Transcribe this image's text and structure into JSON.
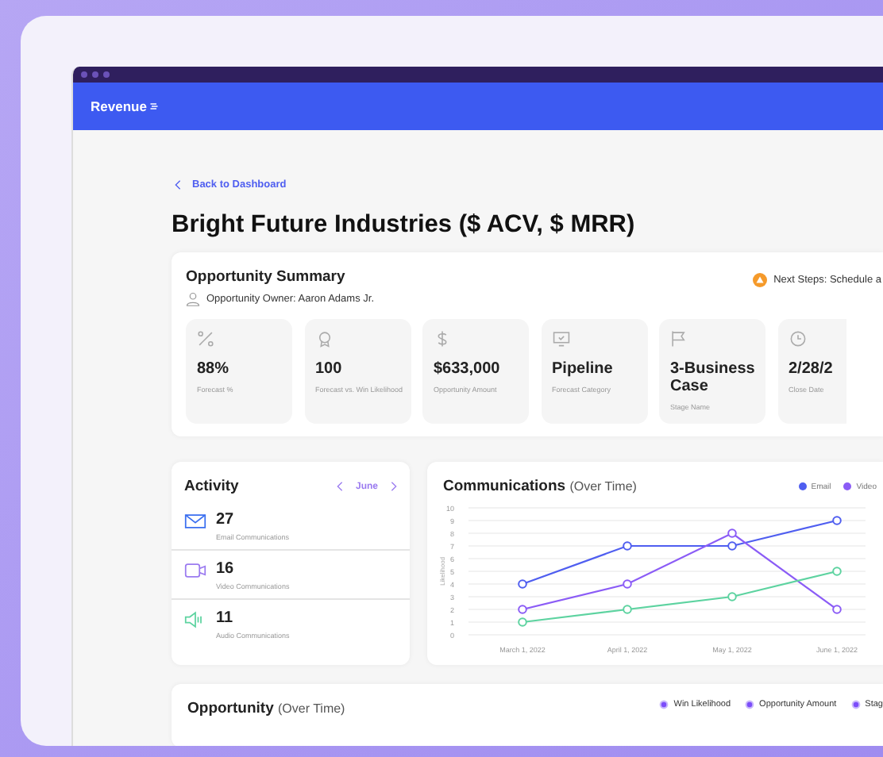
{
  "header": {
    "logo": "Revenue"
  },
  "back_link": "Back to Dashboard",
  "page_title": "Bright Future Industries ($ ACV, $ MRR)",
  "summary": {
    "title": "Opportunity Summary",
    "owner": "Opportunity Owner: Aaron Adams Jr.",
    "next_steps": "Next Steps: Schedule a",
    "metrics": [
      {
        "kind": "percent",
        "value": "88%",
        "label": "Forecast %"
      },
      {
        "kind": "award",
        "value": "100",
        "label": "Forecast vs. Win Likelihood"
      },
      {
        "kind": "dollar",
        "value": "$633,000",
        "label": "Opportunity Amount"
      },
      {
        "kind": "monitor",
        "value": "Pipeline",
        "label": "Forecast Category"
      },
      {
        "kind": "flag",
        "value": "3-Business Case",
        "label": "Stage Name"
      },
      {
        "kind": "clock",
        "value": "2/28/2",
        "label": "Close Date"
      }
    ]
  },
  "activity": {
    "title": "Activity",
    "month": "June",
    "items": [
      {
        "kind": "email",
        "count": "27",
        "label": "Email Communications"
      },
      {
        "kind": "video",
        "count": "16",
        "label": "Video Communications"
      },
      {
        "kind": "audio",
        "count": "11",
        "label": "Audio Communications"
      }
    ]
  },
  "communications": {
    "title": "Communications",
    "subtitle": "(Over Time)",
    "chart_data": {
      "type": "line",
      "ylabel": "Likelihood",
      "categories": [
        "March 1, 2022",
        "April 1, 2022",
        "May 1, 2022",
        "June 1, 2022"
      ],
      "ylim": [
        0,
        10
      ],
      "yticks": [
        0,
        1,
        2,
        3,
        4,
        5,
        6,
        7,
        8,
        9,
        10
      ],
      "grid": true,
      "series": [
        {
          "name": "Email",
          "color": "#4f5ef0",
          "marker": true,
          "values": [
            4,
            7,
            7,
            9
          ]
        },
        {
          "name": "Video",
          "color": "#8b5cf6",
          "marker": true,
          "values": [
            2,
            4,
            8,
            2
          ]
        },
        {
          "color": "#5dd3a0",
          "marker": true,
          "values": [
            1,
            2,
            3,
            5
          ]
        }
      ]
    }
  },
  "opportunity": {
    "title": "Opportunity",
    "subtitle": "(Over Time)",
    "legend": [
      "Win Likelihood",
      "Opportunity Amount",
      "Stag"
    ]
  }
}
